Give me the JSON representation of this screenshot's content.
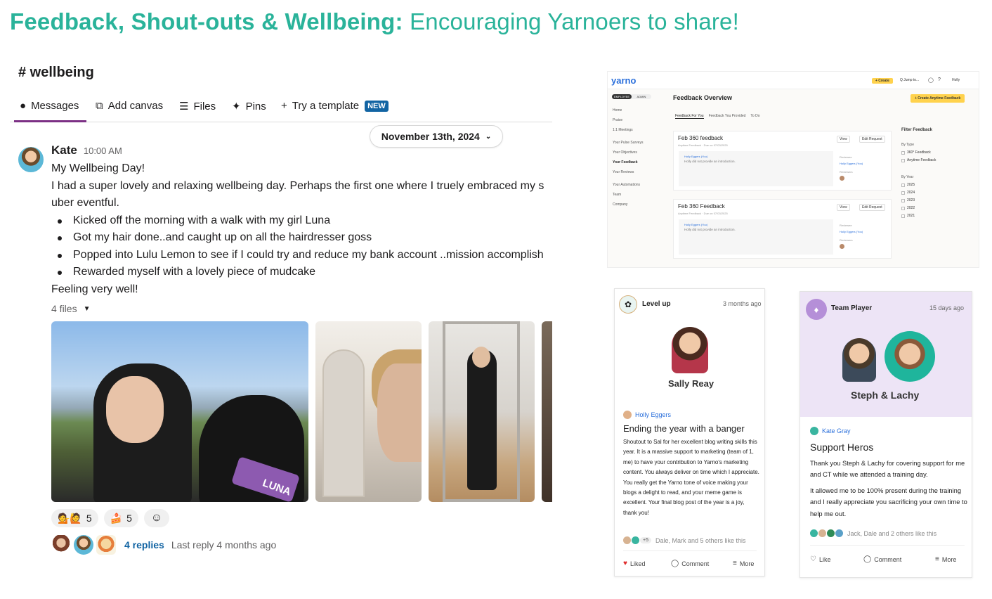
{
  "slide": {
    "title_bold": "Feedback, Shout-outs & Wellbeing:",
    "title_light": "Encouraging Yarnoers to share!",
    "accent_color": "#2ab39a"
  },
  "slack": {
    "channel": "# wellbeing",
    "tabs": [
      {
        "label": "Messages",
        "icon": "message-icon"
      },
      {
        "label": "Add canvas",
        "icon": "canvas-icon"
      },
      {
        "label": "Files",
        "icon": "files-icon"
      },
      {
        "label": "Pins",
        "icon": "pin-icon"
      },
      {
        "label": "Try a template",
        "icon": "plus-icon",
        "badge": "NEW"
      }
    ],
    "date_pill": "November 13th, 2024",
    "message": {
      "author": "Kate",
      "time": "10:00 AM",
      "lines": [
        "My Wellbeing Day!",
        "I had a super lovely and relaxing wellbeing day. Perhaps the first one where I truely embraced my s",
        "uber eventful."
      ],
      "bullets": [
        "Kicked off the morning with a walk with my girl Luna",
        "Got my hair done..and caught up on all the hairdresser goss",
        "Popped into Lulu Lemon to see if I could try and reduce my bank account  ..mission accomplish",
        "Rewarded myself with a lovely piece of mudcake"
      ],
      "closing": "Feeling very well!",
      "files_label": "4 files",
      "photo_text": "LUNA"
    },
    "reactions": [
      {
        "emoji": "💁🙋",
        "count": "5"
      },
      {
        "emoji": "🍰",
        "count": "5"
      }
    ],
    "thread": {
      "replies": "4 replies",
      "last_reply": "Last reply 4 months ago"
    }
  },
  "yarno": {
    "logo": "yarno",
    "create": "+ Create",
    "jump": "Q  Jump to...",
    "user": "Holly",
    "toggle": [
      "EMPLOYEE",
      "ADMIN"
    ],
    "nav": [
      "Home",
      "Praise",
      "1:1 Meetings",
      "Your Pulse Surveys",
      "Your Objectives",
      "Your Feedback",
      "Your Reviews",
      "Your Automations",
      "Team",
      "Company"
    ],
    "page_title": "Feedback Overview",
    "anytime_button": "+ Create Anytime Feedback",
    "subtabs": [
      "Feedback For You",
      "Feedback You Provided",
      "To Do"
    ],
    "cards": [
      {
        "title": "Feb 360 feedback",
        "sub": "Anytime Feedback  ·  Due on 07/03/2025",
        "who": "Holly Eggers (You)",
        "intro": "Holly did not provide an introduction.",
        "reviewee_label": "Reviewee",
        "reviewee": "Holly Eggers (You)",
        "reviewers_label": "Reviewers"
      },
      {
        "title": "Feb 360 Feedback",
        "sub": "Anytime Feedback  ·  Due on 07/03/2025",
        "who": "Holly Eggers (You)",
        "intro": "Holly did not provide an introduction.",
        "reviewee_label": "Reviewee",
        "reviewee": "Holly Eggers (You)",
        "reviewers_label": "Reviewers"
      }
    ],
    "view": "View",
    "edit": "Edit Request",
    "filter": {
      "title": "Filter Feedback",
      "by_type": "By Type",
      "types": [
        "360° Feedback",
        "Anytime Feedback"
      ],
      "by_year": "By Year",
      "years": [
        "2025",
        "2024",
        "2023",
        "2022",
        "2021"
      ]
    }
  },
  "levelup": {
    "badge": "Level up",
    "ago": "3 months ago",
    "recipient": "Sally Reay",
    "giver": "Holly Eggers",
    "headline": "Ending the year with a banger",
    "text": "Shoutout to Sal for her excellent blog writing skills this year. It is a massive support to marketing (team of 1, me) to have your contribution to Yarno's marketing content. You always deliver on time which I appreciate. You really get the Yarno tone of voice making your blogs a delight to read, and your meme game is excellent. Your final blog post of the year is a joy, thank you!",
    "plus": "+5",
    "likers": "Dale, Mark and 5 others like this",
    "liked": "Liked",
    "comment": "Comment",
    "more": "More"
  },
  "team": {
    "badge": "Team Player",
    "ago": "15 days ago",
    "recipient": "Steph & Lachy",
    "giver": "Kate Gray",
    "headline": "Support Heros",
    "text1": "Thank you Steph & Lachy for covering support for me and CT while we attended a training day.",
    "text2": "It allowed me to be 100% present during the training and I really appreciate you sacrificing your own time to help me out.",
    "likers": "Jack, Dale and 2 others like this",
    "like": "Like",
    "comment": "Comment",
    "more": "More"
  }
}
